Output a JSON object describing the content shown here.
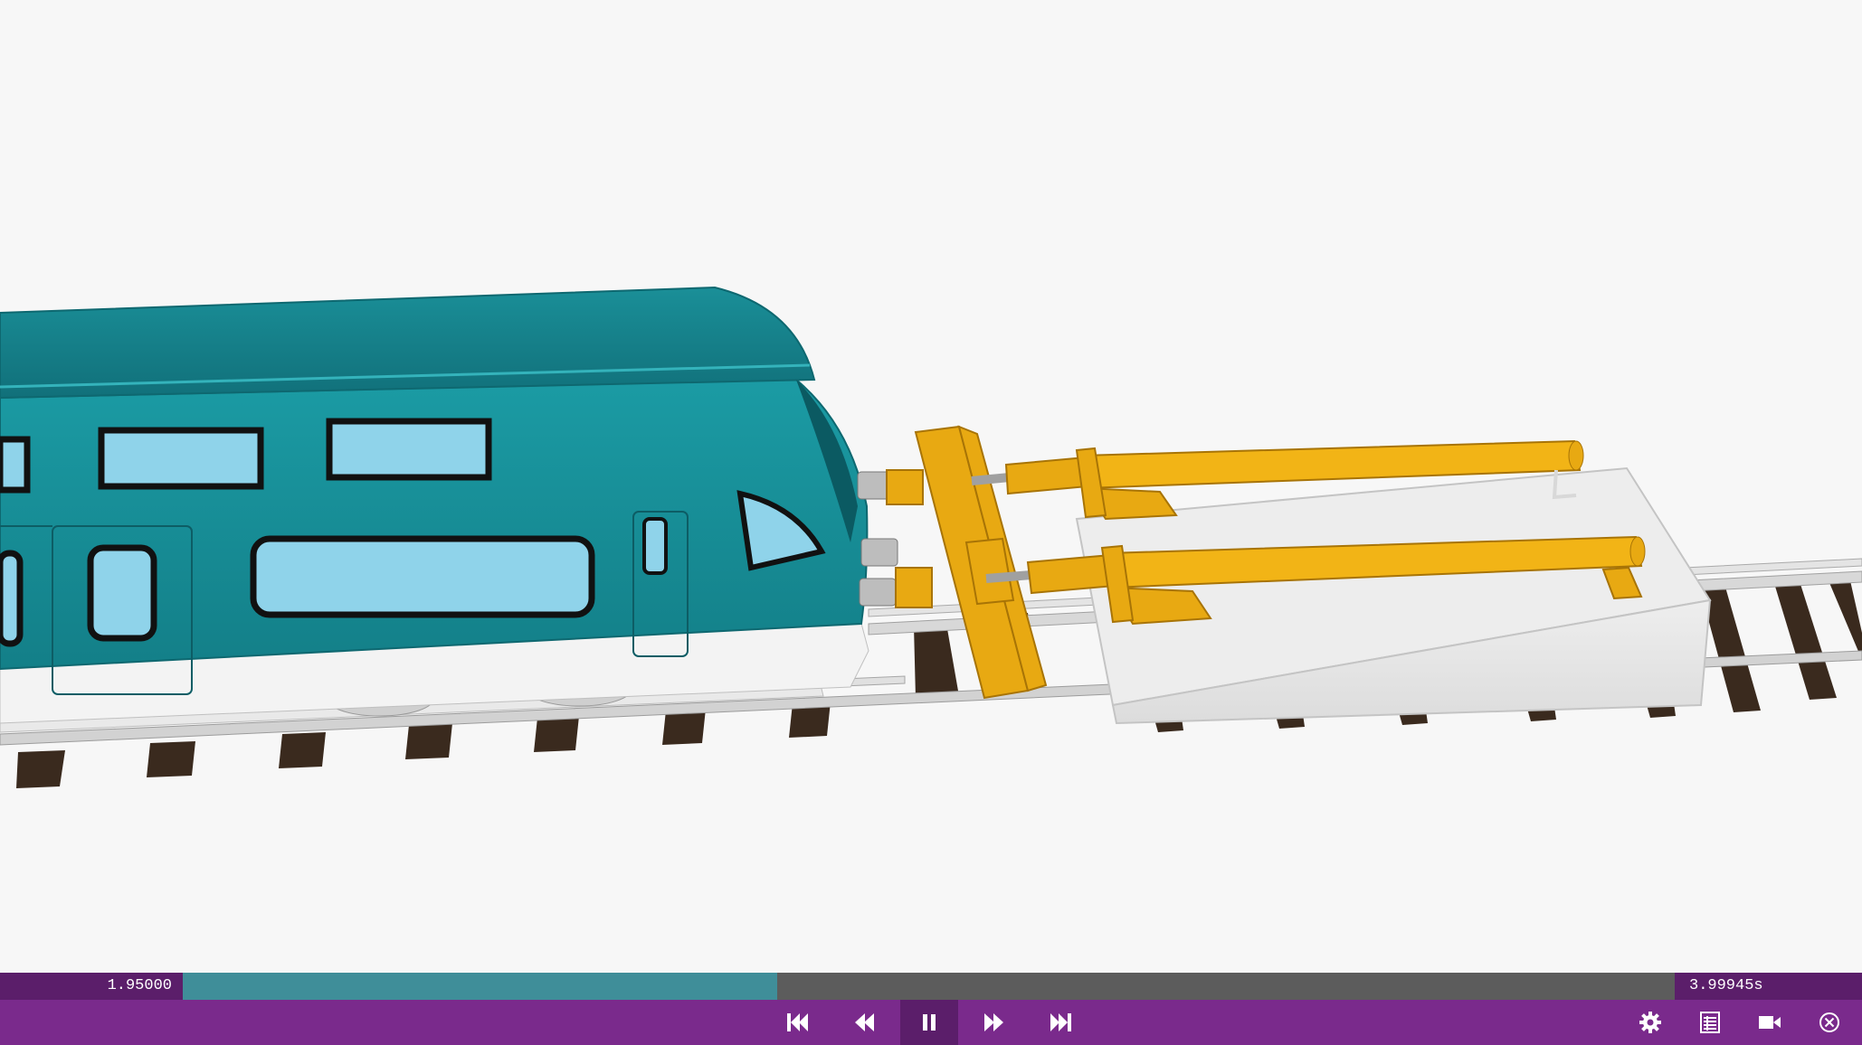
{
  "scene": {
    "description_icon": "train-crash-simulation-viewport",
    "colors": {
      "train_body": "#178f98",
      "train_roof": "#1d8a92",
      "window": "#8fd3ea",
      "buffer_frame": "#e7a812",
      "block": "#e4e4e4",
      "sleeper": "#3b2a1e",
      "rail": "#c9c9c9"
    }
  },
  "timeline": {
    "current_time": "1.95000",
    "end_time": "3.99945s",
    "progress": 0.3985
  },
  "controls": {
    "skip_start_icon": "skip-to-start-icon",
    "step_back_icon": "step-back-icon",
    "pause_icon": "pause-icon",
    "step_forward_icon": "step-forward-icon",
    "skip_end_icon": "skip-to-end-icon",
    "settings_icon": "gear-icon",
    "table_icon": "table-icon",
    "camera_icon": "camera-icon",
    "close_icon": "close-circle-icon",
    "bar_color": "#7a2a8c",
    "timeline_color": "#5b1e6a",
    "accent": "#3f8e99"
  }
}
